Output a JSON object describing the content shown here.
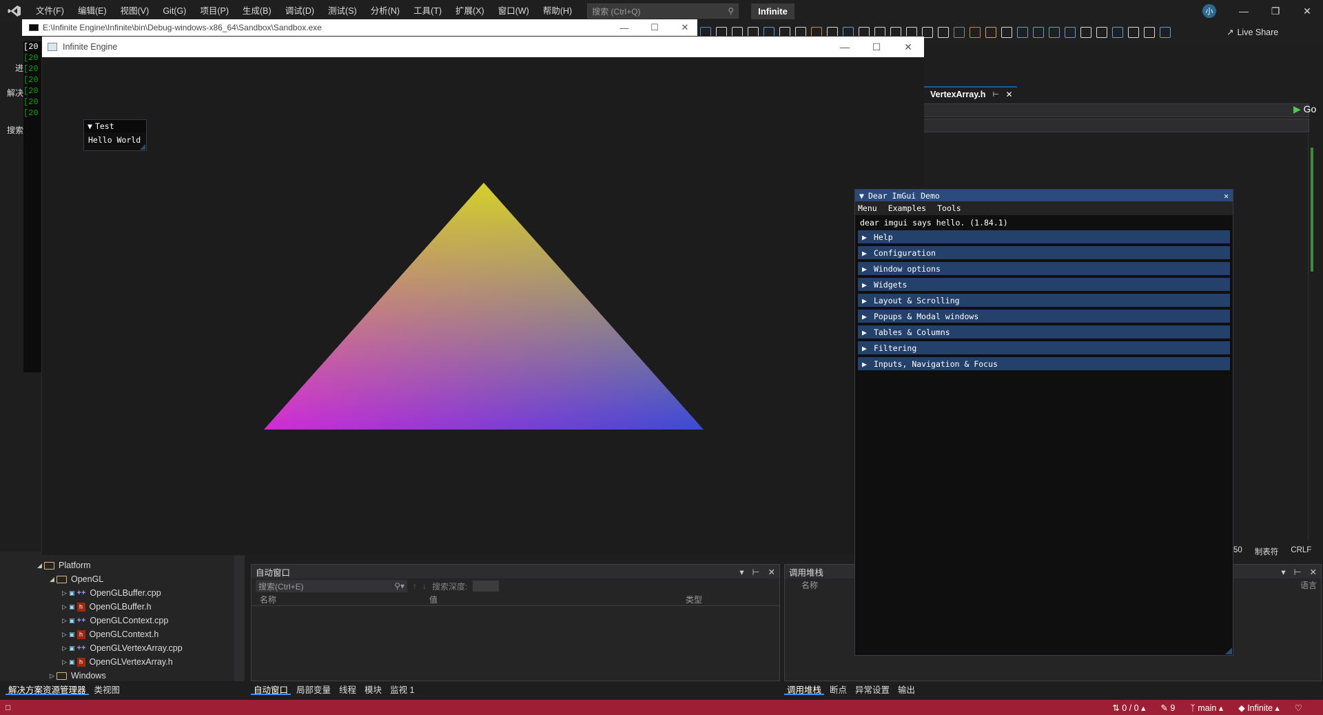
{
  "vs": {
    "menu": [
      "文件(F)",
      "编辑(E)",
      "视图(V)",
      "Git(G)",
      "项目(P)",
      "生成(B)",
      "调试(D)",
      "测试(S)",
      "分析(N)",
      "工具(T)",
      "扩展(X)",
      "窗口(W)",
      "帮助(H)"
    ],
    "search_placeholder": "搜索 (Ctrl+Q)",
    "solution_name": "Infinite",
    "user_initial": "小",
    "live_share": "Live Share",
    "left_fragments": {
      "solution_label": "解决",
      "search_label": "搜索",
      "progress_label": "进Inf"
    },
    "console_lines": [
      "[20",
      "[20",
      "[20",
      "[20",
      "[20",
      "[20",
      "[20"
    ],
    "editor": {
      "tab": "VertexArray.h",
      "go_label": "Go",
      "status": [
        "50",
        "制表符",
        "CRLF"
      ]
    },
    "solution_tree": [
      {
        "label": "Platform",
        "type": "folder",
        "indent": 0,
        "expanded": true
      },
      {
        "label": "OpenGL",
        "type": "folder",
        "indent": 1,
        "expanded": true
      },
      {
        "label": "OpenGLBuffer.cpp",
        "type": "cpp",
        "indent": 2
      },
      {
        "label": "OpenGLBuffer.h",
        "type": "h",
        "indent": 2
      },
      {
        "label": "OpenGLContext.cpp",
        "type": "cpp",
        "indent": 2
      },
      {
        "label": "OpenGLContext.h",
        "type": "h",
        "indent": 2
      },
      {
        "label": "OpenGLVertexArray.cpp",
        "type": "cpp",
        "indent": 2
      },
      {
        "label": "OpenGLVertexArray.h",
        "type": "h",
        "indent": 2
      },
      {
        "label": "Windows",
        "type": "folder",
        "indent": 1,
        "expanded": false
      }
    ],
    "sol_tabs": [
      "解决方案资源管理器",
      "类视图"
    ],
    "autos": {
      "title": "自动窗口",
      "search": "搜索(Ctrl+E)",
      "depth_label": "搜索深度:",
      "columns": [
        "名称",
        "值",
        "类型"
      ],
      "tabs": [
        "自动窗口",
        "局部变量",
        "线程",
        "模块",
        "监视 1"
      ]
    },
    "callstack": {
      "title": "调用堆栈",
      "columns": [
        "名称",
        "语言"
      ],
      "tabs": [
        "调用堆栈",
        "断点",
        "异常设置",
        "输出"
      ]
    },
    "status": {
      "changes": "0 / 0",
      "pencil_count": "9",
      "branch": "main",
      "repo": "Infinite"
    }
  },
  "console_window": {
    "title": "E:\\Infinite Engine\\Infinite\\bin\\Debug-windows-x86_64\\Sandbox\\Sandbox.exe"
  },
  "engine_window": {
    "title": "Infinite Engine",
    "triangle_colors": {
      "top": "#d4d02a",
      "bottom_left": "#d22ad6",
      "bottom_right": "#3a4ad6"
    }
  },
  "imgui_test": {
    "title": "Test",
    "text": "Hello World"
  },
  "imgui_demo": {
    "title": "Dear ImGui Demo",
    "menu": [
      "Menu",
      "Examples",
      "Tools"
    ],
    "hello": "dear imgui says hello. (1.84.1)",
    "headers": [
      "Help",
      "Configuration",
      "Window options",
      "Widgets",
      "Layout & Scrolling",
      "Popups & Modal windows",
      "Tables & Columns",
      "Filtering",
      "Inputs, Navigation & Focus"
    ]
  }
}
